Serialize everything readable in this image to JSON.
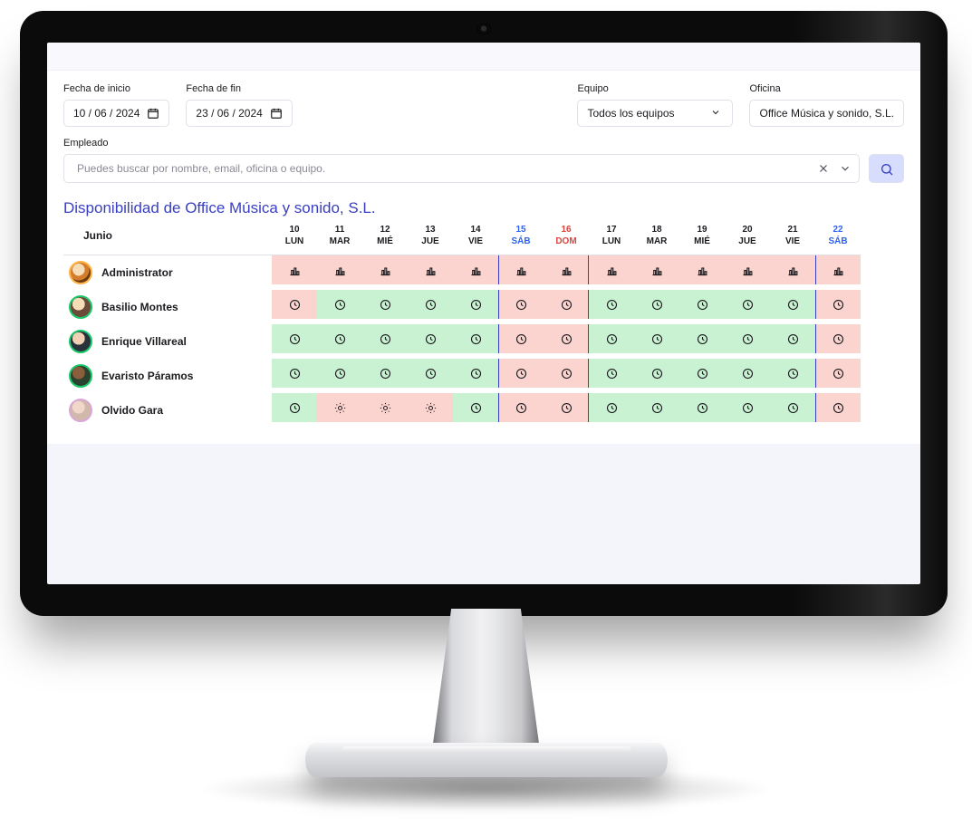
{
  "filters": {
    "start_label": "Fecha de inicio",
    "start_value": "10 / 06 / 2024",
    "end_label": "Fecha de fin",
    "end_value": "23 / 06 / 2024",
    "team_label": "Equipo",
    "team_value": "Todos los equipos",
    "office_label": "Oficina",
    "office_value": "Office Música y sonido, S.L.",
    "employee_label": "Empleado",
    "employee_placeholder": "Puedes buscar por nombre, email, oficina o equipo."
  },
  "title": "Disponibilidad de Office Música y sonido, S.L.",
  "month_label": "Junio",
  "days": [
    {
      "num": "10",
      "dow": "LUN",
      "kind": "wd"
    },
    {
      "num": "11",
      "dow": "MAR",
      "kind": "wd"
    },
    {
      "num": "12",
      "dow": "MIÉ",
      "kind": "wd"
    },
    {
      "num": "13",
      "dow": "JUE",
      "kind": "wd"
    },
    {
      "num": "14",
      "dow": "VIE",
      "kind": "wd"
    },
    {
      "num": "15",
      "dow": "SÁB",
      "kind": "sat"
    },
    {
      "num": "16",
      "dow": "DOM",
      "kind": "sun"
    },
    {
      "num": "17",
      "dow": "LUN",
      "kind": "wd"
    },
    {
      "num": "18",
      "dow": "MAR",
      "kind": "wd"
    },
    {
      "num": "19",
      "dow": "MIÉ",
      "kind": "wd"
    },
    {
      "num": "20",
      "dow": "JUE",
      "kind": "wd"
    },
    {
      "num": "21",
      "dow": "VIE",
      "kind": "wd"
    },
    {
      "num": "22",
      "dow": "SÁB",
      "kind": "sat"
    }
  ],
  "employees": [
    {
      "name": "Administrator",
      "avatar": "admin",
      "cells": [
        {
          "icon": "bar",
          "bg": "red"
        },
        {
          "icon": "bar",
          "bg": "red"
        },
        {
          "icon": "bar",
          "bg": "red"
        },
        {
          "icon": "bar",
          "bg": "red"
        },
        {
          "icon": "bar",
          "bg": "red"
        },
        {
          "icon": "bar",
          "bg": "red"
        },
        {
          "icon": "bar",
          "bg": "red"
        },
        {
          "icon": "bar",
          "bg": "red"
        },
        {
          "icon": "bar",
          "bg": "red"
        },
        {
          "icon": "bar",
          "bg": "red"
        },
        {
          "icon": "bar",
          "bg": "red"
        },
        {
          "icon": "bar",
          "bg": "red"
        },
        {
          "icon": "bar",
          "bg": "red"
        }
      ]
    },
    {
      "name": "Basilio Montes",
      "avatar": "u2",
      "cells": [
        {
          "icon": "clock",
          "bg": "red"
        },
        {
          "icon": "clock",
          "bg": "green"
        },
        {
          "icon": "clock",
          "bg": "green"
        },
        {
          "icon": "clock",
          "bg": "green"
        },
        {
          "icon": "clock",
          "bg": "green"
        },
        {
          "icon": "clock",
          "bg": "red"
        },
        {
          "icon": "clock",
          "bg": "red"
        },
        {
          "icon": "clock",
          "bg": "green"
        },
        {
          "icon": "clock",
          "bg": "green"
        },
        {
          "icon": "clock",
          "bg": "green"
        },
        {
          "icon": "clock",
          "bg": "green"
        },
        {
          "icon": "clock",
          "bg": "green"
        },
        {
          "icon": "clock",
          "bg": "red"
        }
      ]
    },
    {
      "name": "Enrique Villareal",
      "avatar": "u3",
      "cells": [
        {
          "icon": "clock",
          "bg": "green"
        },
        {
          "icon": "clock",
          "bg": "green"
        },
        {
          "icon": "clock",
          "bg": "green"
        },
        {
          "icon": "clock",
          "bg": "green"
        },
        {
          "icon": "clock",
          "bg": "green"
        },
        {
          "icon": "clock",
          "bg": "red"
        },
        {
          "icon": "clock",
          "bg": "red"
        },
        {
          "icon": "clock",
          "bg": "green"
        },
        {
          "icon": "clock",
          "bg": "green"
        },
        {
          "icon": "clock",
          "bg": "green"
        },
        {
          "icon": "clock",
          "bg": "green"
        },
        {
          "icon": "clock",
          "bg": "green"
        },
        {
          "icon": "clock",
          "bg": "red"
        }
      ]
    },
    {
      "name": "Evaristo Páramos",
      "avatar": "u4",
      "cells": [
        {
          "icon": "clock",
          "bg": "green"
        },
        {
          "icon": "clock",
          "bg": "green"
        },
        {
          "icon": "clock",
          "bg": "green"
        },
        {
          "icon": "clock",
          "bg": "green"
        },
        {
          "icon": "clock",
          "bg": "green"
        },
        {
          "icon": "clock",
          "bg": "red"
        },
        {
          "icon": "clock",
          "bg": "red"
        },
        {
          "icon": "clock",
          "bg": "green"
        },
        {
          "icon": "clock",
          "bg": "green"
        },
        {
          "icon": "clock",
          "bg": "green"
        },
        {
          "icon": "clock",
          "bg": "green"
        },
        {
          "icon": "clock",
          "bg": "green"
        },
        {
          "icon": "clock",
          "bg": "red"
        }
      ]
    },
    {
      "name": "Olvido Gara",
      "avatar": "u5",
      "cells": [
        {
          "icon": "clock",
          "bg": "green"
        },
        {
          "icon": "sun",
          "bg": "red"
        },
        {
          "icon": "sun",
          "bg": "red"
        },
        {
          "icon": "sun",
          "bg": "red"
        },
        {
          "icon": "clock",
          "bg": "green"
        },
        {
          "icon": "clock",
          "bg": "red"
        },
        {
          "icon": "clock",
          "bg": "red"
        },
        {
          "icon": "clock",
          "bg": "green"
        },
        {
          "icon": "clock",
          "bg": "green"
        },
        {
          "icon": "clock",
          "bg": "green"
        },
        {
          "icon": "clock",
          "bg": "green"
        },
        {
          "icon": "clock",
          "bg": "green"
        },
        {
          "icon": "clock",
          "bg": "red"
        }
      ]
    }
  ]
}
